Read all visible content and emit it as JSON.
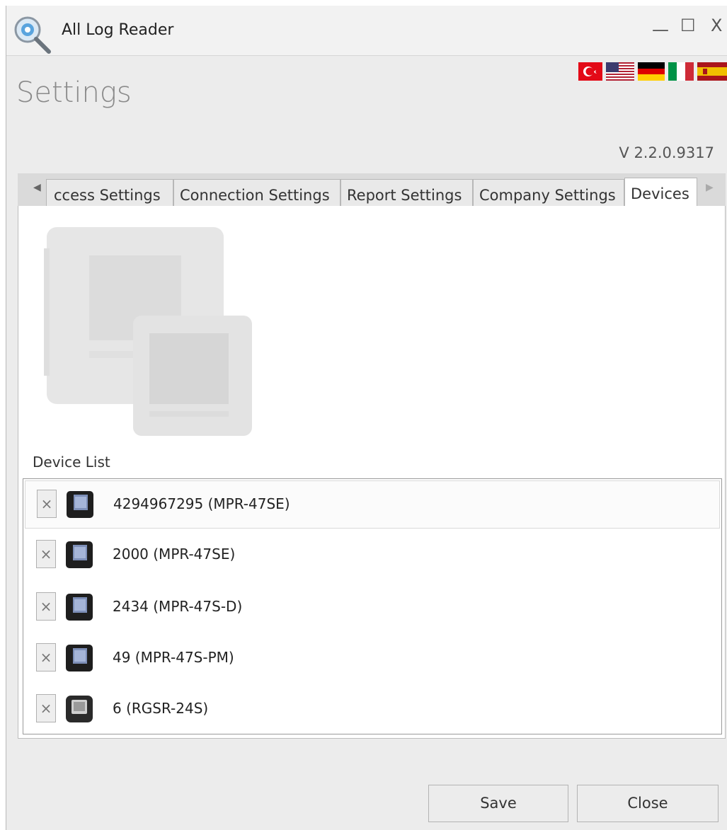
{
  "window": {
    "title": "All Log Reader",
    "controls": {
      "minimize": "—",
      "maximize": "☐",
      "close": "X"
    }
  },
  "header": {
    "page_title": "Settings",
    "version": "V 2.2.0.9317",
    "flags": [
      "flag-turkey-icon",
      "flag-usa-icon",
      "flag-germany-icon",
      "flag-italy-icon",
      "flag-spain-icon"
    ]
  },
  "tabs": {
    "items": [
      {
        "label": "Access Settings",
        "visible_text": "ccess Settings"
      },
      {
        "label": "Connection Settings"
      },
      {
        "label": "Report Settings"
      },
      {
        "label": "Company Settings"
      },
      {
        "label": "Devices",
        "active": true
      }
    ],
    "scroll_left": "◀",
    "scroll_right": "▶"
  },
  "devices_panel": {
    "list_label": "Device List",
    "devices": [
      {
        "label": "4294967295 (MPR-47SE)",
        "icon": "mpr-device-icon",
        "selected": true
      },
      {
        "label": "2000 (MPR-47SE)",
        "icon": "mpr-device-icon"
      },
      {
        "label": "2434 (MPR-47S-D)",
        "icon": "mpr-device-icon"
      },
      {
        "label": "49 (MPR-47S-PM)",
        "icon": "mpr-device-icon"
      },
      {
        "label": "6 (RGSR-24S)",
        "icon": "rgsr-device-icon"
      }
    ],
    "remove_symbol": "×"
  },
  "footer": {
    "save_label": "Save",
    "close_label": "Close"
  },
  "colors": {
    "window_bg": "#ececec",
    "content_bg": "#ffffff",
    "title_gray": "#8a8a8a"
  }
}
